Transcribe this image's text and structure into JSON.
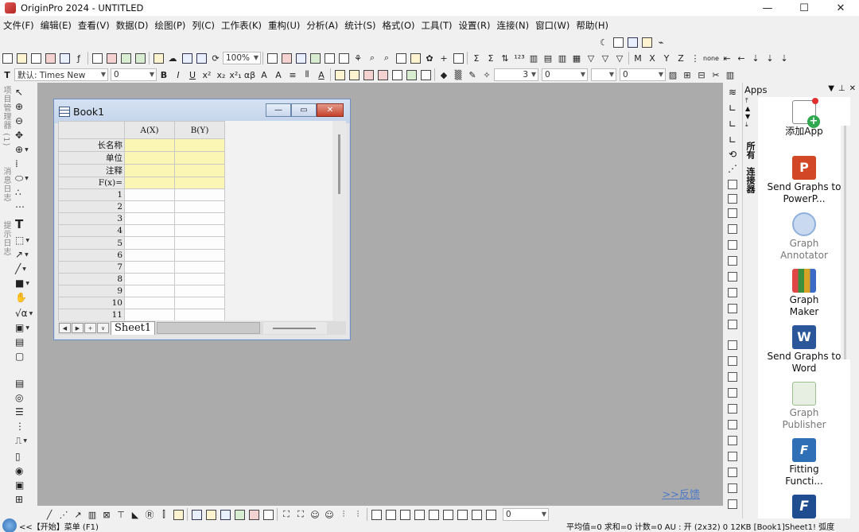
{
  "window": {
    "title": "OriginPro 2024 - UNTITLED",
    "controls": [
      "—",
      "☐",
      "✕"
    ]
  },
  "menu": [
    "文件(F)",
    "编辑(E)",
    "查看(V)",
    "数据(D)",
    "绘图(P)",
    "列(C)",
    "工作表(K)",
    "重构(U)",
    "分析(A)",
    "统计(S)",
    "格式(O)",
    "工具(T)",
    "设置(R)",
    "连接(N)",
    "窗口(W)",
    "帮助(H)"
  ],
  "toolbar": {
    "zoom": "100%",
    "font_name": "默认: Times New",
    "font_size": "0",
    "line_width": "0",
    "line_width2": "0",
    "none_label": "none",
    "pattern_label": "3"
  },
  "left_tabs": [
    "项目管理器 (1)",
    "消息日志",
    "提示日志"
  ],
  "book": {
    "title": "Book1",
    "columns": [
      "A(X)",
      "B(Y)"
    ],
    "header_rows": [
      "长名称",
      "单位",
      "注释",
      "F(x)="
    ],
    "rows": [
      "1",
      "2",
      "3",
      "4",
      "5",
      "6",
      "7",
      "8",
      "9",
      "10",
      "11"
    ],
    "sheet_tab": "Sheet1"
  },
  "feedback": ">>反馈",
  "apps": {
    "header": "Apps",
    "tabs": [
      "所有",
      "连接器"
    ],
    "items": [
      {
        "name": "添加App",
        "icon": "add-app-icon",
        "dim": false
      },
      {
        "name": "Send Graphs to PowerP...",
        "icon": "powerpoint-icon",
        "dim": false
      },
      {
        "name": "Graph Annotator",
        "icon": "graph-annotator-icon",
        "dim": true
      },
      {
        "name": "Graph Maker",
        "icon": "graph-maker-icon",
        "dim": false
      },
      {
        "name": "Send Graphs to Word",
        "icon": "word-icon",
        "dim": false
      },
      {
        "name": "Graph Publisher",
        "icon": "graph-publisher-icon",
        "dim": true
      },
      {
        "name": "Fitting Functi...",
        "icon": "fitting-function-icon",
        "dim": false
      }
    ]
  },
  "status": {
    "start": "<<【开始】菜单 (F1)",
    "stats": "平均值=0 求和=0 计数=0    AU : 开    (2x32) 0    12KB    [Book1]Sheet1!    弧度"
  },
  "colors": {
    "workspace": "#ababab",
    "header_highlight": "#fcf6b4",
    "close_button": "#c6412b",
    "link": "#4f7ac7"
  }
}
